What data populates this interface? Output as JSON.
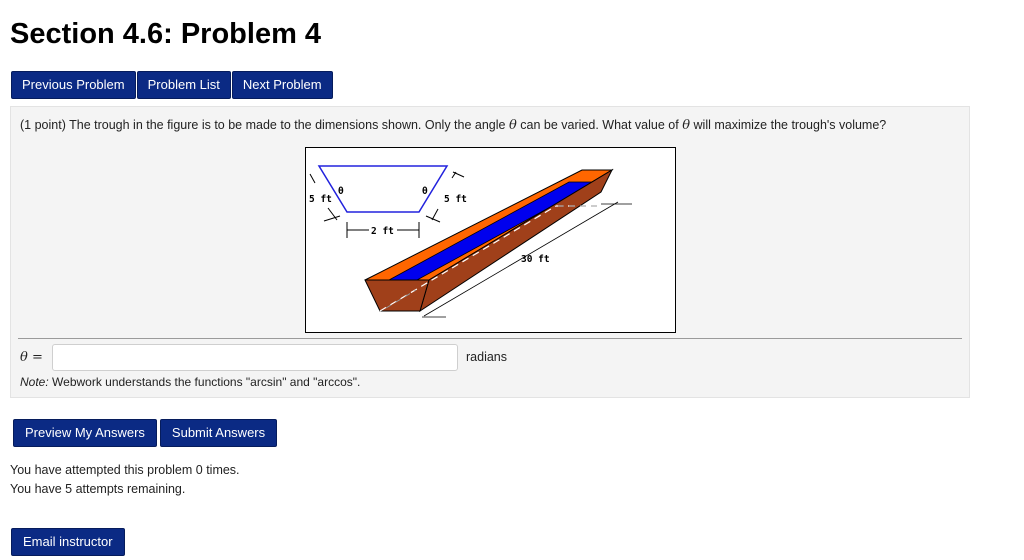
{
  "page": {
    "title": "Section 4.6: Problem 4"
  },
  "nav": {
    "previous_label": "Previous Problem",
    "list_label": "Problem List",
    "next_label": "Next Problem"
  },
  "problem": {
    "points": "(1 point)",
    "text_part1": "The trough in the figure is to be made to the dimensions shown. Only the angle",
    "theta_symbol": "θ",
    "text_part2": "can be varied. What value of",
    "text_part3": "will maximize the trough's volume?",
    "figure": {
      "label_5ft_left": "5 ft",
      "label_5ft_right": "5 ft",
      "label_2ft": "2 ft",
      "label_30ft": "30 ft",
      "label_theta_left": "θ",
      "label_theta_right": "θ",
      "colors": {
        "cross_section": "#2222dd",
        "trough_rim": "#ff6600",
        "trough_water": "#0000ee",
        "trough_side": "#a0401a"
      }
    },
    "answer": {
      "label": "θ =",
      "value": "",
      "placeholder": "",
      "units": "radians"
    },
    "note_label": "Note:",
    "note_text": "Webwork understands the functions \"arcsin\" and \"arccos\"."
  },
  "actions": {
    "preview_label": "Preview My Answers",
    "submit_label": "Submit Answers"
  },
  "status": {
    "attempted": "You have attempted this problem 0 times.",
    "remaining": "You have 5 attempts remaining."
  },
  "footer": {
    "email_label": "Email instructor"
  }
}
